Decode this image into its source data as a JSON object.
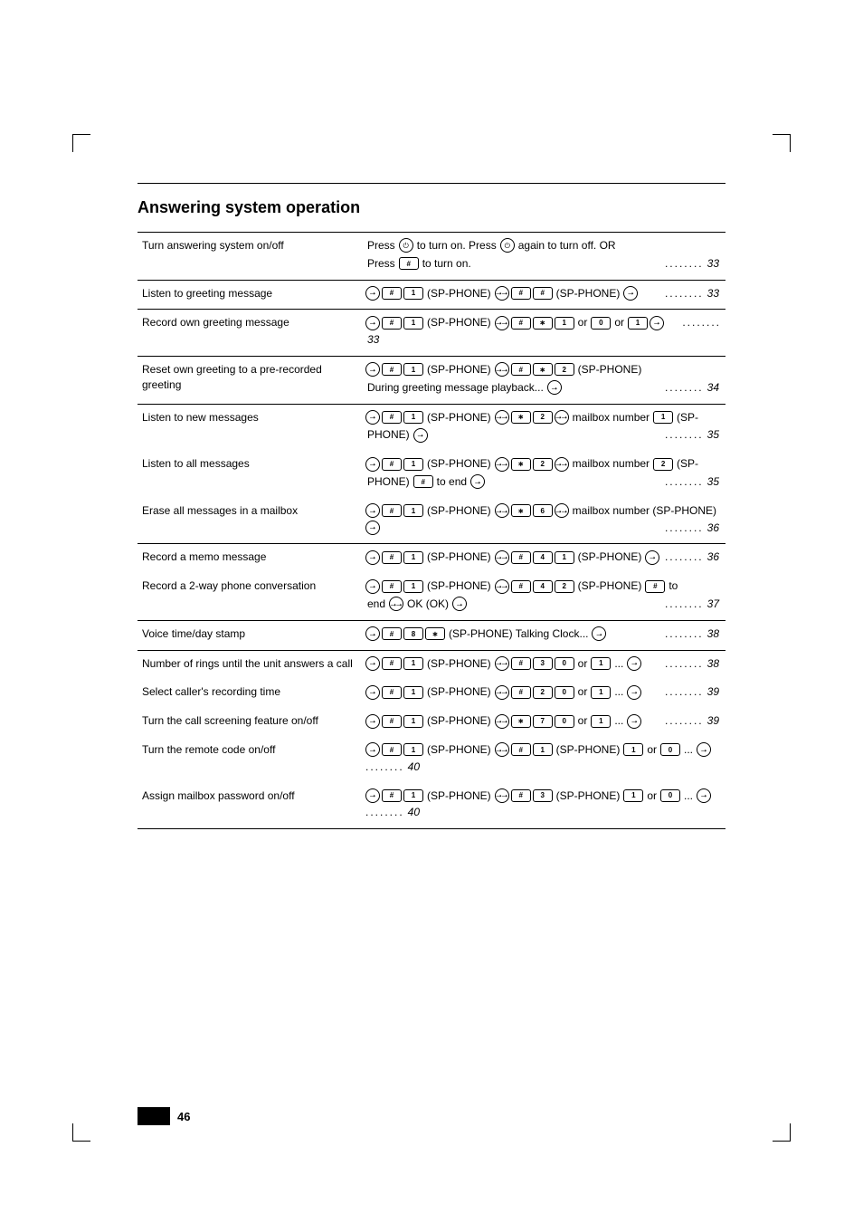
{
  "section_title": "Answering system operation",
  "page_number": "46",
  "glyphs": {
    "power": "⏻",
    "hash": "#",
    "str": "∗",
    "arrow_r": "⭢",
    "arrows": "⭢⭢"
  },
  "rows": [
    {
      "border": true,
      "label": "Turn answering system on/off",
      "lines": [
        {
          "cells": [
            {
              "t": "txt",
              "v": "Press "
            },
            {
              "t": "circ",
              "g": "power"
            },
            {
              "t": "txt",
              "v": " to turn on. Press "
            },
            {
              "t": "circ",
              "g": "power"
            },
            {
              "t": "txt",
              "v": " again to turn off. OR"
            }
          ]
        },
        {
          "cells": [
            {
              "t": "txt",
              "v": "Press "
            },
            {
              "t": "key",
              "g": "hash"
            },
            {
              "t": "txt",
              "v": " to turn on."
            }
          ]
        }
      ]
    },
    {
      "border": true,
      "label": "Listen to greeting message",
      "lines": [
        {
          "cells": [
            {
              "t": "circ",
              "g": "arrow_r"
            },
            {
              "t": "key",
              "g": "hash"
            },
            {
              "t": "key",
              "v": "1"
            },
            {
              "t": "txt",
              "v": " (SP-PHONE) "
            },
            {
              "t": "circ",
              "g": "arrows"
            },
            {
              "t": "key",
              "g": "hash"
            },
            {
              "t": "key",
              "g": "hash"
            },
            {
              "t": "txt",
              "v": " (SP-PHONE) "
            },
            {
              "t": "circ",
              "g": "arrow_r"
            }
          ]
        }
      ]
    },
    {
      "border": true,
      "label": "Record own greeting message",
      "lines": [
        {
          "cells": [
            {
              "t": "circ",
              "g": "arrow_r"
            },
            {
              "t": "key",
              "g": "hash"
            },
            {
              "t": "key",
              "v": "1"
            },
            {
              "t": "txt",
              "v": " (SP-PHONE) "
            },
            {
              "t": "circ",
              "g": "arrows"
            },
            {
              "t": "key",
              "g": "hash"
            },
            {
              "t": "key",
              "g": "str"
            },
            {
              "t": "key",
              "v": "1"
            },
            {
              "t": "txt",
              "v": " or "
            },
            {
              "t": "key",
              "v": "0"
            },
            {
              "t": "txt",
              "v": " or "
            },
            {
              "t": "key",
              "v": "1"
            },
            {
              "t": "circ",
              "g": "arrow_r"
            }
          ]
        }
      ]
    },
    {
      "border": true,
      "label": "Reset own greeting to a pre-recorded greeting",
      "lines": [
        {
          "cells": [
            {
              "t": "circ",
              "g": "arrow_r"
            },
            {
              "t": "key",
              "g": "hash"
            },
            {
              "t": "key",
              "v": "1"
            },
            {
              "t": "txt",
              "v": " (SP-PHONE) "
            },
            {
              "t": "circ",
              "g": "arrows"
            },
            {
              "t": "key",
              "g": "hash"
            },
            {
              "t": "key",
              "g": "str"
            },
            {
              "t": "key",
              "v": "2"
            },
            {
              "t": "txt",
              "v": " (SP-PHONE)"
            }
          ]
        },
        {
          "cells": [
            {
              "t": "txt",
              "v": "During greeting message playback... "
            },
            {
              "t": "circ",
              "g": "arrow_r"
            }
          ]
        }
      ]
    },
    {
      "border": true,
      "label": "Listen to new messages",
      "lines": [
        {
          "cells": [
            {
              "t": "circ",
              "g": "arrow_r"
            },
            {
              "t": "key",
              "g": "hash"
            },
            {
              "t": "key",
              "v": "1"
            },
            {
              "t": "txt",
              "v": " (SP-PHONE) "
            },
            {
              "t": "circ",
              "g": "arrows"
            },
            {
              "t": "key",
              "g": "str"
            },
            {
              "t": "key",
              "v": "2"
            },
            {
              "t": "circ",
              "g": "arrows"
            },
            {
              "t": "txt",
              "v": " mailbox number "
            },
            {
              "t": "key",
              "v": "1"
            },
            {
              "t": "txt",
              "v": " (SP-"
            }
          ]
        },
        {
          "cells": [
            {
              "t": "txt",
              "v": "PHONE) "
            },
            {
              "t": "circ",
              "g": "arrow_r"
            }
          ]
        }
      ]
    },
    {
      "border": false,
      "label": "Listen to all messages",
      "lines": [
        {
          "cells": [
            {
              "t": "circ",
              "g": "arrow_r"
            },
            {
              "t": "key",
              "g": "hash"
            },
            {
              "t": "key",
              "v": "1"
            },
            {
              "t": "txt",
              "v": " (SP-PHONE) "
            },
            {
              "t": "circ",
              "g": "arrows"
            },
            {
              "t": "key",
              "g": "str"
            },
            {
              "t": "key",
              "v": "2"
            },
            {
              "t": "circ",
              "g": "arrows"
            },
            {
              "t": "txt",
              "v": " mailbox number "
            },
            {
              "t": "key",
              "v": "2"
            },
            {
              "t": "txt",
              "v": " (SP-"
            }
          ]
        },
        {
          "cells": [
            {
              "t": "txt",
              "v": "PHONE) "
            },
            {
              "t": "key",
              "g": "hash"
            },
            {
              "t": "txt",
              "v": " to end "
            },
            {
              "t": "circ",
              "g": "arrow_r"
            }
          ]
        }
      ]
    },
    {
      "border": false,
      "label": "Erase all messages in a mailbox",
      "lines": [
        {
          "cells": [
            {
              "t": "circ",
              "g": "arrow_r"
            },
            {
              "t": "key",
              "g": "hash"
            },
            {
              "t": "key",
              "v": "1"
            },
            {
              "t": "txt",
              "v": " (SP-PHONE) "
            },
            {
              "t": "circ",
              "g": "arrows"
            },
            {
              "t": "key",
              "g": "str"
            },
            {
              "t": "key",
              "v": "6"
            },
            {
              "t": "circ",
              "g": "arrows"
            },
            {
              "t": "txt",
              "v": " mailbox number (SP-PHONE) "
            },
            {
              "t": "circ",
              "g": "arrow_r"
            }
          ]
        }
      ]
    },
    {
      "border": true,
      "label": "Record a memo message",
      "lines": [
        {
          "cells": [
            {
              "t": "circ",
              "g": "arrow_r"
            },
            {
              "t": "key",
              "g": "hash"
            },
            {
              "t": "key",
              "v": "1"
            },
            {
              "t": "txt",
              "v": " (SP-PHONE) "
            },
            {
              "t": "circ",
              "g": "arrows"
            },
            {
              "t": "key",
              "g": "hash"
            },
            {
              "t": "key",
              "v": "4"
            },
            {
              "t": "key",
              "v": "1"
            },
            {
              "t": "txt",
              "v": " (SP-PHONE) "
            },
            {
              "t": "circ",
              "g": "arrow_r"
            }
          ]
        }
      ]
    },
    {
      "border": false,
      "label": "Record a 2-way phone conversation",
      "lines": [
        {
          "cells": [
            {
              "t": "circ",
              "g": "arrow_r"
            },
            {
              "t": "key",
              "g": "hash"
            },
            {
              "t": "key",
              "v": "1"
            },
            {
              "t": "txt",
              "v": " (SP-PHONE) "
            },
            {
              "t": "circ",
              "g": "arrows"
            },
            {
              "t": "key",
              "g": "hash"
            },
            {
              "t": "key",
              "v": "4"
            },
            {
              "t": "key",
              "v": "2"
            },
            {
              "t": "txt",
              "v": " (SP-PHONE) "
            },
            {
              "t": "key",
              "g": "hash"
            },
            {
              "t": "txt",
              "v": " to"
            }
          ]
        },
        {
          "cells": [
            {
              "t": "txt",
              "v": "end "
            },
            {
              "t": "circ",
              "g": "arrows"
            },
            {
              "t": "txt",
              "v": " OK (OK) "
            },
            {
              "t": "circ",
              "g": "arrow_r"
            }
          ]
        }
      ]
    },
    {
      "border": true,
      "label": "Voice time/day stamp",
      "lines": [
        {
          "cells": [
            {
              "t": "circ",
              "g": "arrow_r"
            },
            {
              "t": "key",
              "g": "hash"
            },
            {
              "t": "key",
              "v": "8"
            },
            {
              "t": "key",
              "g": "str"
            },
            {
              "t": "txt",
              "v": " (SP-PHONE) Talking Clock... "
            },
            {
              "t": "circ",
              "g": "arrow_r"
            }
          ]
        }
      ]
    },
    {
      "border": true,
      "label": "Number of rings until the unit answers a call",
      "lines": [
        {
          "cells": [
            {
              "t": "circ",
              "g": "arrow_r"
            },
            {
              "t": "key",
              "g": "hash"
            },
            {
              "t": "key",
              "v": "1"
            },
            {
              "t": "txt",
              "v": " (SP-PHONE) "
            },
            {
              "t": "circ",
              "g": "arrows"
            },
            {
              "t": "key",
              "g": "hash"
            },
            {
              "t": "key",
              "v": "3"
            },
            {
              "t": "key",
              "v": "0"
            },
            {
              "t": "txt",
              "v": " or "
            },
            {
              "t": "key",
              "v": "1"
            },
            {
              "t": "txt",
              "v": " ... "
            },
            {
              "t": "circ",
              "g": "arrow_r"
            }
          ]
        }
      ]
    },
    {
      "border": false,
      "label": "Select caller's recording time",
      "lines": [
        {
          "cells": [
            {
              "t": "circ",
              "g": "arrow_r"
            },
            {
              "t": "key",
              "g": "hash"
            },
            {
              "t": "key",
              "v": "1"
            },
            {
              "t": "txt",
              "v": " (SP-PHONE) "
            },
            {
              "t": "circ",
              "g": "arrows"
            },
            {
              "t": "key",
              "g": "hash"
            },
            {
              "t": "key",
              "v": "2"
            },
            {
              "t": "key",
              "v": "0"
            },
            {
              "t": "txt",
              "v": " or "
            },
            {
              "t": "key",
              "v": "1"
            },
            {
              "t": "txt",
              "v": " ... "
            },
            {
              "t": "circ",
              "g": "arrow_r"
            }
          ]
        }
      ]
    },
    {
      "border": false,
      "label": "Turn the call screening feature on/off",
      "lines": [
        {
          "cells": [
            {
              "t": "circ",
              "g": "arrow_r"
            },
            {
              "t": "key",
              "g": "hash"
            },
            {
              "t": "key",
              "v": "1"
            },
            {
              "t": "txt",
              "v": " (SP-PHONE) "
            },
            {
              "t": "circ",
              "g": "arrows"
            },
            {
              "t": "key",
              "g": "str"
            },
            {
              "t": "key",
              "v": "7"
            },
            {
              "t": "key",
              "v": "0"
            },
            {
              "t": "txt",
              "v": " or "
            },
            {
              "t": "key",
              "v": "1"
            },
            {
              "t": "txt",
              "v": " ... "
            },
            {
              "t": "circ",
              "g": "arrow_r"
            }
          ]
        }
      ]
    },
    {
      "border": false,
      "label": "Turn the remote code on/off",
      "lines": [
        {
          "cells": [
            {
              "t": "circ",
              "g": "arrow_r"
            },
            {
              "t": "key",
              "g": "hash"
            },
            {
              "t": "key",
              "v": "1"
            },
            {
              "t": "txt",
              "v": " (SP-PHONE) "
            },
            {
              "t": "circ",
              "g": "arrows"
            },
            {
              "t": "key",
              "g": "hash"
            },
            {
              "t": "key",
              "v": "1"
            },
            {
              "t": "txt",
              "v": " (SP-PHONE) "
            },
            {
              "t": "key",
              "v": "1"
            },
            {
              "t": "txt",
              "v": " or "
            },
            {
              "t": "key",
              "v": "0"
            },
            {
              "t": "txt",
              "v": " ... "
            },
            {
              "t": "circ",
              "g": "arrow_r"
            }
          ]
        }
      ]
    },
    {
      "border": false,
      "label": "Assign mailbox password on/off",
      "lines": [
        {
          "cells": [
            {
              "t": "circ",
              "g": "arrow_r"
            },
            {
              "t": "key",
              "g": "hash"
            },
            {
              "t": "key",
              "v": "1"
            },
            {
              "t": "txt",
              "v": " (SP-PHONE) "
            },
            {
              "t": "circ",
              "g": "arrows"
            },
            {
              "t": "key",
              "g": "hash"
            },
            {
              "t": "key",
              "v": "3"
            },
            {
              "t": "txt",
              "v": " (SP-PHONE) "
            },
            {
              "t": "key",
              "v": "1"
            },
            {
              "t": "txt",
              "v": " or "
            },
            {
              "t": "key",
              "v": "0"
            },
            {
              "t": "txt",
              "v": " ... "
            },
            {
              "t": "circ",
              "g": "arrow_r"
            }
          ]
        }
      ]
    }
  ],
  "page_refs": [
    "33",
    "33",
    "33",
    "34",
    "35",
    "35",
    "36",
    "36",
    "37",
    "38",
    "38",
    "39",
    "39",
    "40",
    "40"
  ],
  "last_row_border": true
}
